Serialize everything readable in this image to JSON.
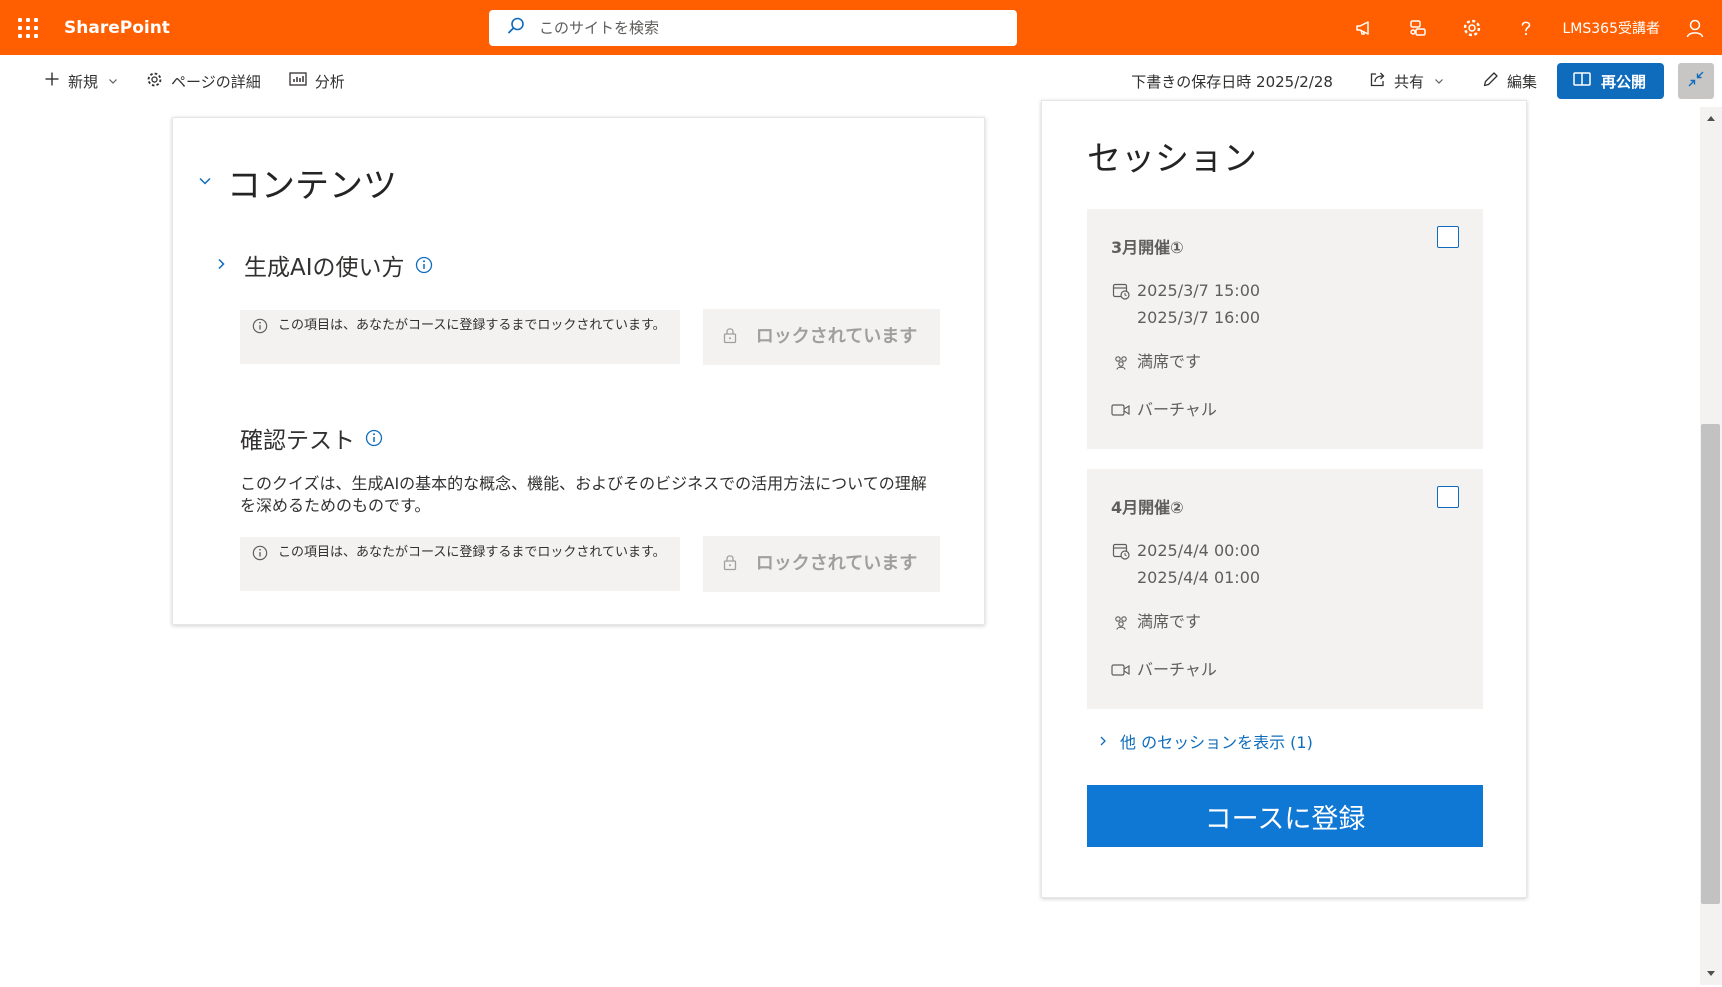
{
  "suite": {
    "brand": "SharePoint",
    "search_placeholder": "このサイトを検索",
    "user": "LMS365受講者"
  },
  "commandbar": {
    "new_label": "新規",
    "page_details_label": "ページの詳細",
    "analytics_label": "分析",
    "draft_saved": "下書きの保存日時 2025/2/28",
    "share_label": "共有",
    "edit_label": "編集",
    "republish_label": "再公開"
  },
  "contents": {
    "title": "コンテンツ",
    "module": {
      "title": "生成AIの使い方",
      "lock_note": "この項目は、あなたがコースに登録するまでロックされています。",
      "lock_button": "ロックされています"
    },
    "quiz": {
      "title": "確認テスト",
      "description": "このクイズは、生成AIの基本的な概念、機能、およびそのビジネスでの活用方法についての理解を深めるためのものです。",
      "lock_note": "この項目は、あなたがコースに登録するまでロックされています。",
      "lock_button": "ロックされています"
    }
  },
  "sessions": {
    "title": "セッション",
    "items": [
      {
        "name": "3月開催①",
        "start": "2025/3/7 15:00",
        "end": "2025/3/7 16:00",
        "capacity": "満席です",
        "location": "バーチャル"
      },
      {
        "name": "4月開催②",
        "start": "2025/4/4 00:00",
        "end": "2025/4/4 01:00",
        "capacity": "満席です",
        "location": "バーチャル"
      }
    ],
    "more_link": "他 のセッションを表示 (1)",
    "enroll_button": "コースに登録"
  },
  "colors": {
    "suite_bar": "#ff5f00",
    "accent": "#0f6cbd",
    "enroll": "#0f78d4"
  }
}
